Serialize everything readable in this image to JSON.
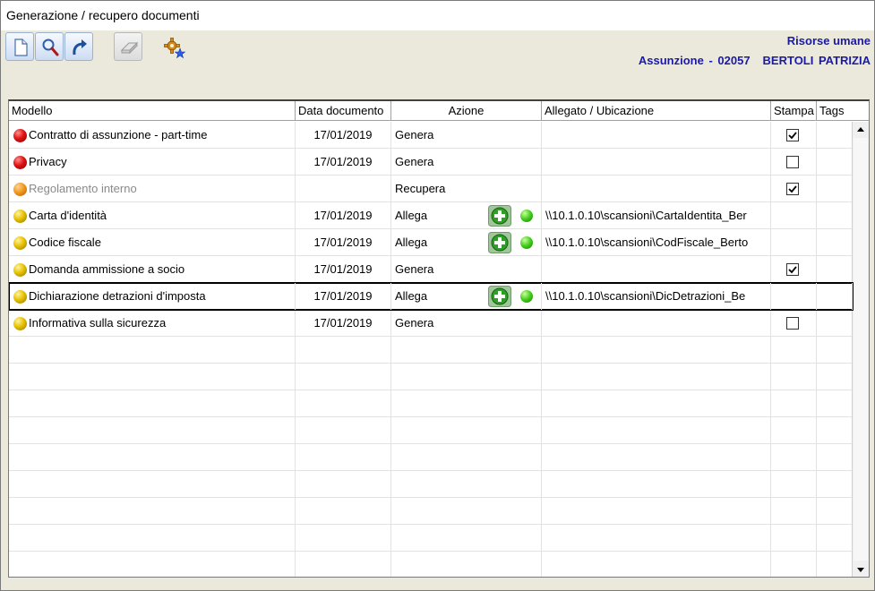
{
  "window": {
    "title": "Generazione / recupero documenti"
  },
  "toolbar": {
    "buttons": [
      {
        "name": "new-document",
        "icon": "new-document-icon"
      },
      {
        "name": "search",
        "icon": "magnifier-icon"
      },
      {
        "name": "redo",
        "icon": "redo-arrow-icon"
      },
      {
        "name": "eraser",
        "icon": "eraser-icon",
        "disabled": true
      },
      {
        "name": "settings",
        "icon": "gear-star-icon"
      }
    ]
  },
  "header": {
    "department": "Risorse umane",
    "assignment_label": "Assunzione - 02057",
    "employee": "BERTOLI PATRIZIA"
  },
  "grid": {
    "columns": {
      "model": "Modello",
      "date": "Data documento",
      "action": "Azione",
      "attachment": "Allegato / Ubicazione",
      "print": "Stampa",
      "tags": "Tags"
    },
    "rows": [
      {
        "status": "red",
        "model": "Contratto di assunzione - part-time",
        "date": "17/01/2019",
        "action": "Genera",
        "attachment": "",
        "print": true,
        "has_print_box": true,
        "has_attach_icons": false
      },
      {
        "status": "red",
        "model": "Privacy",
        "date": "17/01/2019",
        "action": "Genera",
        "attachment": "",
        "print": false,
        "has_print_box": true,
        "has_attach_icons": false
      },
      {
        "status": "orange",
        "model": "Regolamento interno",
        "date": "",
        "action": "Recupera",
        "attachment": "",
        "print": true,
        "has_print_box": true,
        "has_attach_icons": false,
        "muted": true
      },
      {
        "status": "yellow",
        "model": "Carta d'identità",
        "date": "17/01/2019",
        "action": "Allega",
        "attachment": "\\\\10.1.0.10\\scansioni\\CartaIdentita_Ber",
        "print": false,
        "has_print_box": false,
        "has_attach_icons": true
      },
      {
        "status": "yellow",
        "model": "Codice fiscale",
        "date": "17/01/2019",
        "action": "Allega",
        "attachment": "\\\\10.1.0.10\\scansioni\\CodFiscale_Berto",
        "print": false,
        "has_print_box": false,
        "has_attach_icons": true
      },
      {
        "status": "yellow",
        "model": "Domanda ammissione a socio",
        "date": "17/01/2019",
        "action": "Genera",
        "attachment": "",
        "print": true,
        "has_print_box": true,
        "has_attach_icons": false
      },
      {
        "status": "yellow",
        "model": "Dichiarazione detrazioni d'imposta",
        "date": "17/01/2019",
        "action": "Allega",
        "attachment": "\\\\10.1.0.10\\scansioni\\DicDetrazioni_Be",
        "print": false,
        "has_print_box": false,
        "has_attach_icons": true,
        "selected": true
      },
      {
        "status": "yellow",
        "model": "Informativa sulla sicurezza",
        "date": "17/01/2019",
        "action": "Genera",
        "attachment": "",
        "print": false,
        "has_print_box": true,
        "has_attach_icons": false
      }
    ],
    "filler_rows": 9
  },
  "colors": {
    "header_text": "#1a1aa6",
    "status_red": "#e01212",
    "status_orange": "#f39a1e",
    "status_yellow": "#e7c200",
    "ok_green": "#3fcc1a"
  }
}
